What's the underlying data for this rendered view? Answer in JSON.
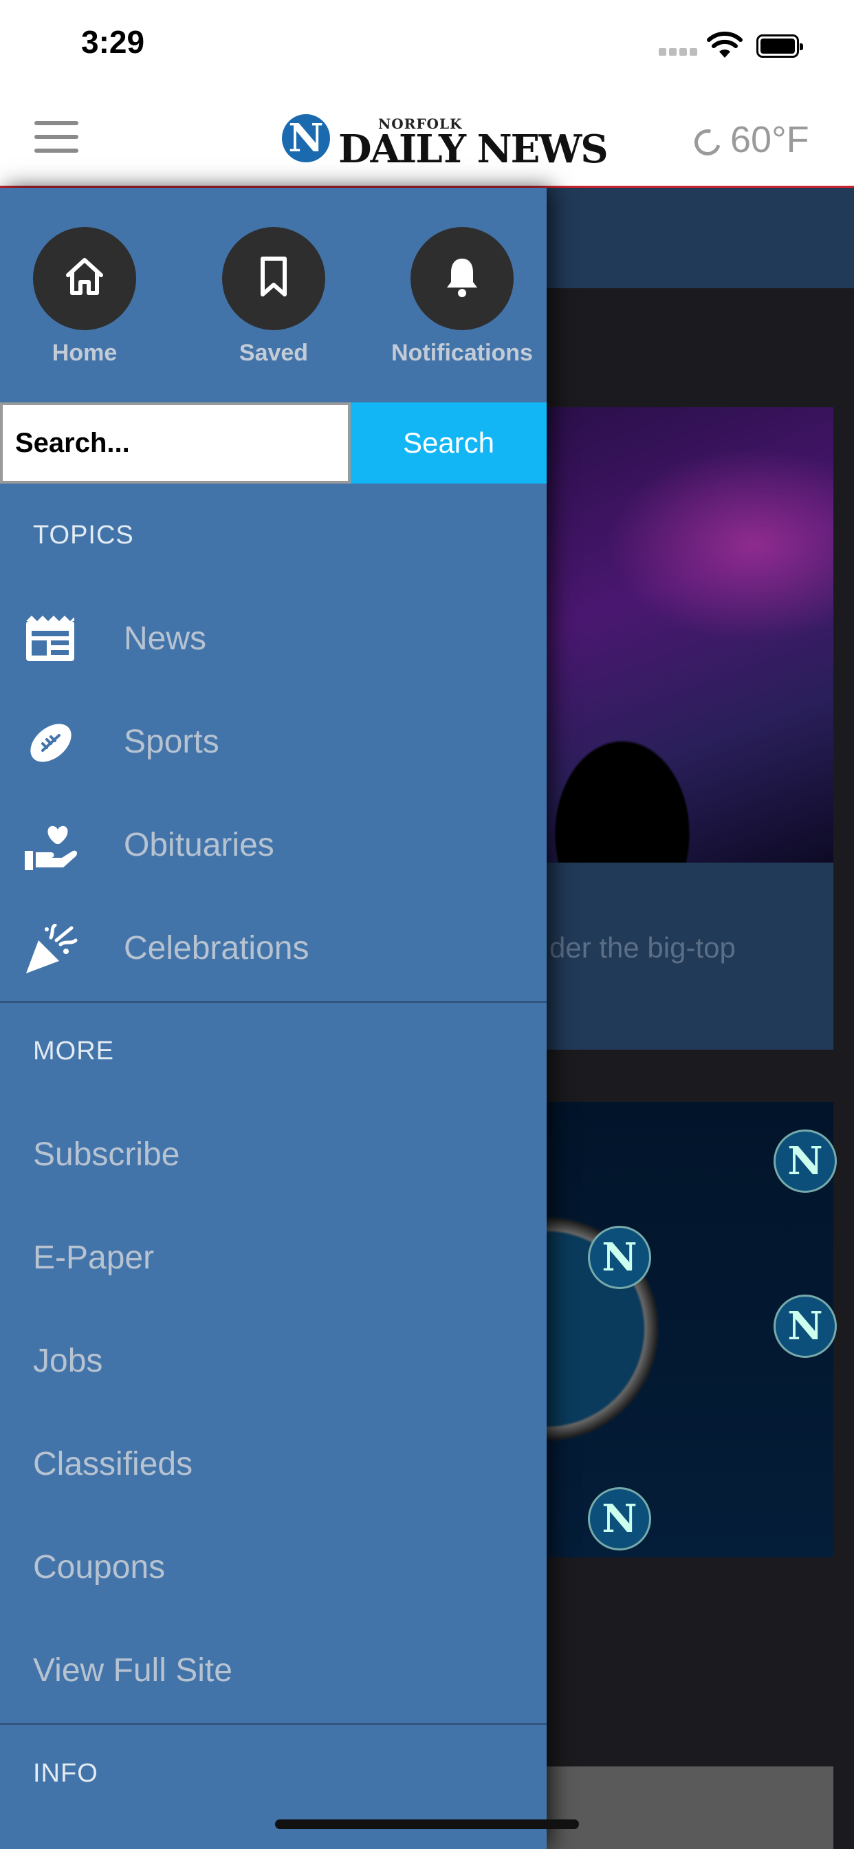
{
  "status_bar": {
    "time": "3:29"
  },
  "header": {
    "logo_letter": "N",
    "logo_top": "NORFOLK",
    "logo_main": "DAILY NEWS",
    "weather": "60°F"
  },
  "background": {
    "caption_fragment": "der the big-top"
  },
  "drawer": {
    "quick_actions": [
      {
        "label": "Home",
        "icon": "home-icon"
      },
      {
        "label": "Saved",
        "icon": "bookmark-icon"
      },
      {
        "label": "Notifications",
        "icon": "bell-icon"
      }
    ],
    "search": {
      "placeholder": "Search...",
      "button_label": "Search"
    },
    "topics_heading": "TOPICS",
    "topics": [
      {
        "label": "News",
        "icon": "newspaper-icon"
      },
      {
        "label": "Sports",
        "icon": "football-icon"
      },
      {
        "label": "Obituaries",
        "icon": "heart-hand-icon"
      },
      {
        "label": "Celebrations",
        "icon": "party-popper-icon"
      }
    ],
    "more_heading": "MORE",
    "more_items": [
      "Subscribe",
      "E-Paper",
      "Jobs",
      "Classifieds",
      "Coupons",
      "View Full Site"
    ],
    "info_heading": "INFO"
  }
}
